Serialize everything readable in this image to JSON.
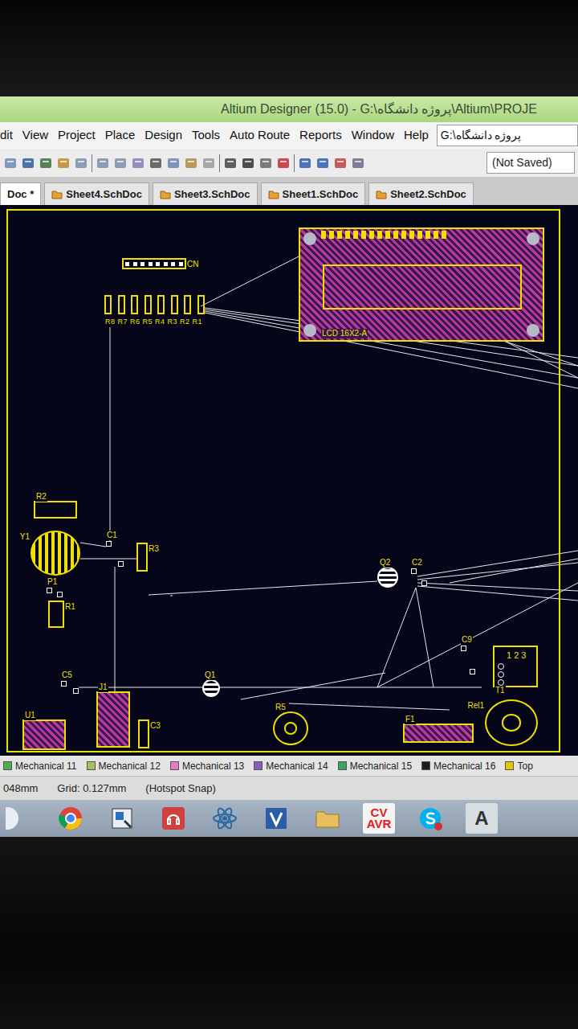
{
  "window": {
    "title": "Altium Designer (15.0) - G:\\پروژه دانشگاه\\Altium\\PROJE"
  },
  "menu": {
    "items": [
      "dit",
      "View",
      "Project",
      "Place",
      "Design",
      "Tools",
      "Auto Route",
      "Reports",
      "Window",
      "Help"
    ],
    "path": "G:\\پروژه دانشگاه"
  },
  "toolbar": {
    "save_state": "(Not Saved)"
  },
  "doc_tabs": [
    {
      "label": "Doc *",
      "selected": true
    },
    {
      "label": "Sheet4.SchDoc",
      "selected": false
    },
    {
      "label": "Sheet3.SchDoc",
      "selected": false
    },
    {
      "label": "Sheet1.SchDoc",
      "selected": false
    },
    {
      "label": "Sheet2.SchDoc",
      "selected": false
    }
  ],
  "pcb": {
    "components": [
      {
        "label": "LCD 16X2-A",
        "kind": "lcd"
      },
      {
        "label": "CN",
        "kind": "header"
      },
      {
        "label": "R8 R7 R6 R5 R4 R3 R2 R1",
        "kind": "resnet"
      },
      {
        "label": "R2",
        "kind": "resistor"
      },
      {
        "label": "Y1",
        "kind": "circle"
      },
      {
        "label": "C1",
        "kind": "cap"
      },
      {
        "label": "R3",
        "kind": "resistor"
      },
      {
        "label": "P1",
        "kind": "cap"
      },
      {
        "label": "R1",
        "kind": "resistor"
      },
      {
        "label": "Q2",
        "kind": "transistor"
      },
      {
        "label": "C2",
        "kind": "cap"
      },
      {
        "label": "Q1",
        "kind": "transistor"
      },
      {
        "label": "C5",
        "kind": "cap"
      },
      {
        "label": "J1",
        "kind": "ic"
      },
      {
        "label": "U1",
        "kind": "ic"
      },
      {
        "label": "T1",
        "kind": "connector",
        "pins": "1 2 3"
      },
      {
        "label": "Rel1",
        "kind": "round"
      },
      {
        "label": "R5",
        "kind": "round"
      },
      {
        "label": "F1",
        "kind": "ic"
      },
      {
        "label": "C9",
        "kind": "cap"
      },
      {
        "label": "C3",
        "kind": "resistor"
      }
    ]
  },
  "layer_tabs": [
    {
      "label": "Mechanical 11",
      "color": "#4caf50"
    },
    {
      "label": "Mechanical 12",
      "color": "#a6c25a"
    },
    {
      "label": "Mechanical 13",
      "color": "#e07cc8"
    },
    {
      "label": "Mechanical 14",
      "color": "#8a5cc0"
    },
    {
      "label": "Mechanical 15",
      "color": "#3fa35f"
    },
    {
      "label": "Mechanical 16",
      "color": "#1e1e1e"
    },
    {
      "label": "Top",
      "color": "#e8c400"
    }
  ],
  "status_bar": [
    "048mm",
    "Grid: 0.127mm",
    "(Hotspot Snap)"
  ],
  "taskbar": {
    "cv": "CV",
    "avr": "AVR",
    "a": "A"
  }
}
